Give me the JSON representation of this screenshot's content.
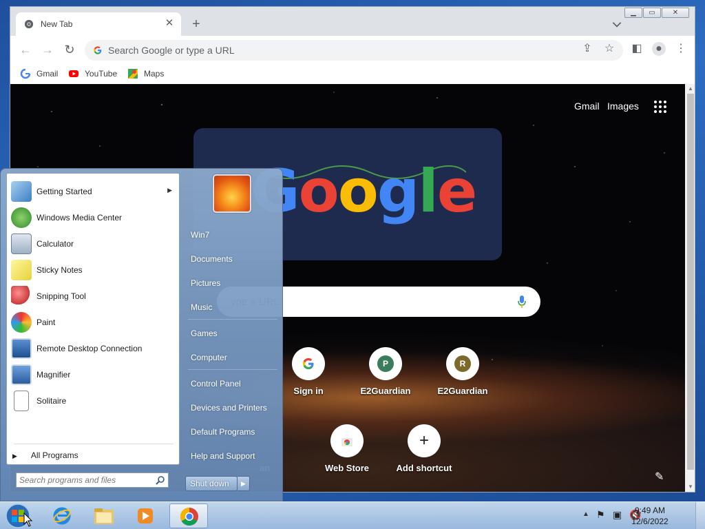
{
  "browser": {
    "tab_title": "New Tab",
    "omnibox_placeholder": "Search Google or type a URL",
    "bookmarks": [
      {
        "label": "Gmail",
        "icon": "google-g-icon"
      },
      {
        "label": "YouTube",
        "icon": "youtube-icon"
      },
      {
        "label": "Maps",
        "icon": "maps-icon"
      }
    ]
  },
  "ntp": {
    "top_links": [
      "Gmail",
      "Images"
    ],
    "doodle_word": "Google",
    "search_partial": "ype a URL",
    "shortcuts_row1": [
      {
        "label": "Sign in",
        "icon": "google-g-icon"
      },
      {
        "label": "E2Guardian",
        "letter": "P",
        "color": "#3a7d5c"
      },
      {
        "label": "E2Guardian",
        "letter": "R",
        "color": "#7d6a2a"
      }
    ],
    "shortcuts_row2": [
      {
        "label": "an",
        "partial": true
      },
      {
        "label": "Web Store",
        "icon": "web-store-icon"
      },
      {
        "label": "Add shortcut",
        "icon": "plus-icon"
      }
    ]
  },
  "start_menu": {
    "programs": [
      {
        "label": "Getting Started",
        "has_submenu": true,
        "icon": "getting-started-icon"
      },
      {
        "label": "Windows Media Center",
        "icon": "media-center-icon"
      },
      {
        "label": "Calculator",
        "icon": "calculator-icon"
      },
      {
        "label": "Sticky Notes",
        "icon": "sticky-notes-icon"
      },
      {
        "label": "Snipping Tool",
        "icon": "snipping-tool-icon"
      },
      {
        "label": "Paint",
        "icon": "paint-icon"
      },
      {
        "label": "Remote Desktop Connection",
        "icon": "remote-desktop-icon"
      },
      {
        "label": "Magnifier",
        "icon": "magnifier-icon"
      },
      {
        "label": "Solitaire",
        "icon": "solitaire-icon"
      }
    ],
    "all_programs": "All Programs",
    "search_placeholder": "Search programs and files",
    "right_links": [
      "Win7",
      "Documents",
      "Pictures",
      "Music",
      "Games",
      "Computer",
      "Control Panel",
      "Devices and Printers",
      "Default Programs",
      "Help and Support"
    ],
    "shutdown_label": "Shut down"
  },
  "taskbar": {
    "time": "9:49 AM",
    "date": "12/6/2022"
  }
}
